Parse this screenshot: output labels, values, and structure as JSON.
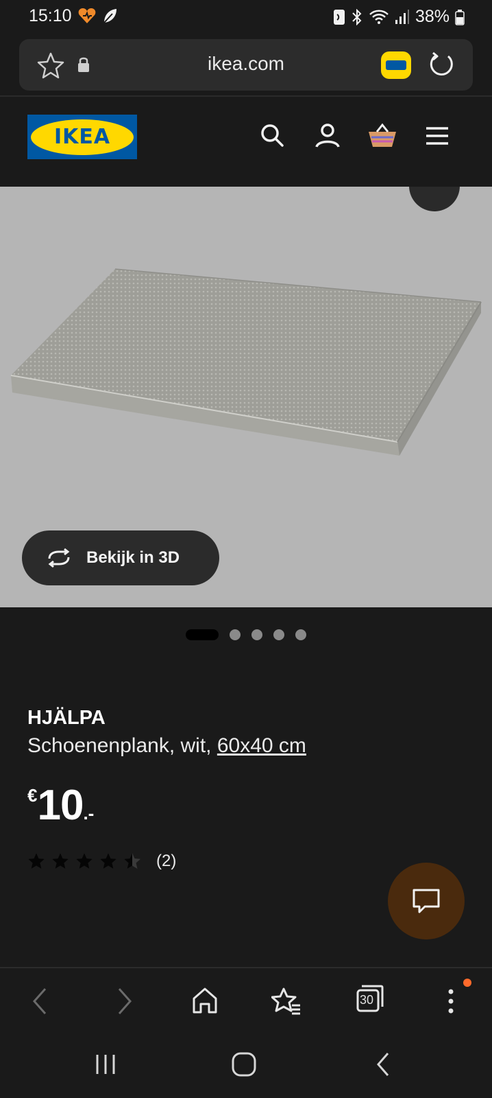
{
  "status_bar": {
    "time": "15:10",
    "battery_percent": "38%"
  },
  "browser": {
    "url": "ikea.com",
    "badge_text": "IKEA"
  },
  "site": {
    "logo_text": "IKEA",
    "header_icons": [
      "search-icon",
      "account-icon",
      "basket-icon",
      "menu-icon"
    ]
  },
  "product": {
    "view_3d_label": "Bekijk in 3D",
    "name": "HJÄLPA",
    "description": "Schoenenplank, wit, ",
    "size": "60x40 cm",
    "price_currency": "€",
    "price_integer": "10",
    "price_decimal": ".-",
    "rating": 4.5,
    "rating_count": "(2)",
    "carousel_total": 5,
    "carousel_active": 1
  },
  "browser_nav": {
    "tabs_count": "30"
  },
  "colors": {
    "background": "#1a1a1a",
    "ikea_blue": "#0058a3",
    "ikea_yellow": "#ffd800",
    "image_bg": "#b5b5b5",
    "chat_button": "#4a2a0d",
    "notification": "#ff6a2b"
  }
}
